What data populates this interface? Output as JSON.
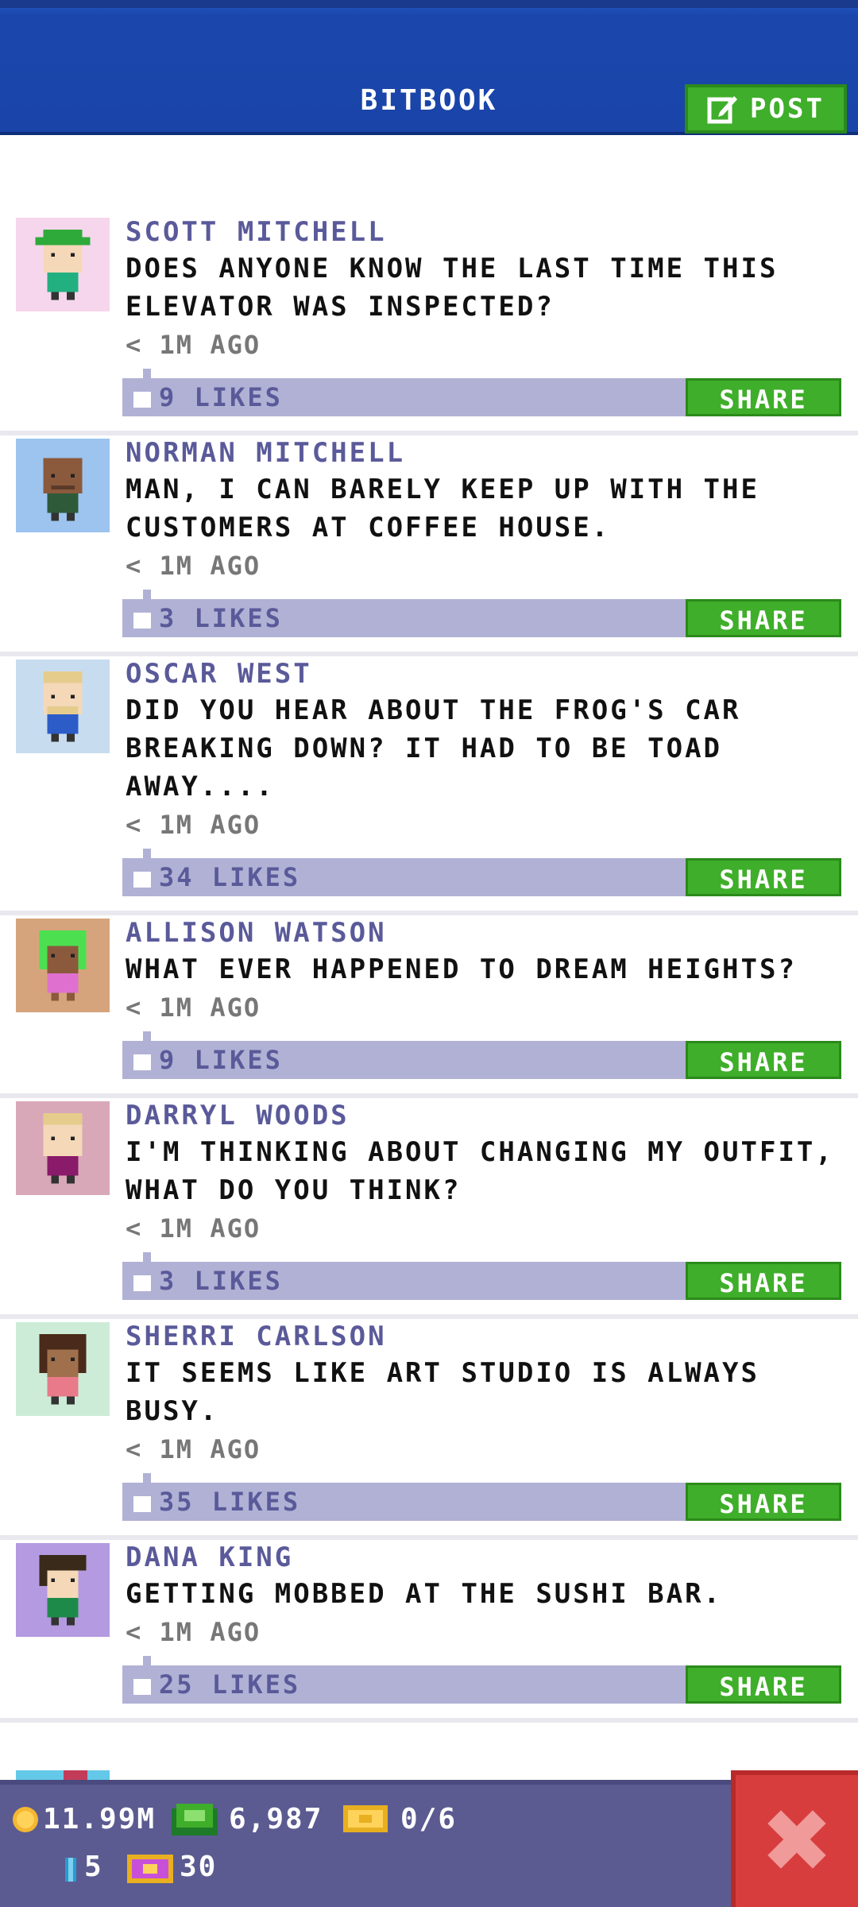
{
  "header": {
    "title": "BITBOOK",
    "post_label": "POST"
  },
  "posts": [
    {
      "name": "SCOTT MITCHELL",
      "message": "DOES ANYONE KNOW THE LAST TIME THIS ELEVATOR WAS INSPECTED?",
      "time": "< 1M AGO",
      "likes": "9 LIKES",
      "share": "SHARE",
      "avatar_bg": "#f6d6ec",
      "shirt": "#22b080",
      "hair": "#2eaa3a",
      "skin": "#f4d8b8"
    },
    {
      "name": "NORMAN MITCHELL",
      "message": "MAN, I CAN BARELY KEEP UP WITH THE CUSTOMERS AT COFFEE HOUSE.",
      "time": "< 1M AGO",
      "likes": "3 LIKES",
      "share": "SHARE",
      "avatar_bg": "#9cc4ee",
      "shirt": "#2e5a3a",
      "hair": "#8b5a3c",
      "skin": "#8b5a3c"
    },
    {
      "name": "OSCAR WEST",
      "message": "DID YOU HEAR ABOUT THE FROG'S CAR BREAKING DOWN? IT HAD TO BE TOAD AWAY....",
      "time": "< 1M AGO",
      "likes": "34 LIKES",
      "share": "SHARE",
      "avatar_bg": "#c8dcef",
      "shirt": "#2c5cc8",
      "hair": "#e6cc8c",
      "skin": "#f4d8b8"
    },
    {
      "name": "ALLISON WATSON",
      "message": "WHAT EVER HAPPENED TO DREAM HEIGHTS?",
      "time": "< 1M AGO",
      "likes": "9 LIKES",
      "share": "SHARE",
      "avatar_bg": "#d6a47c",
      "shirt": "#e070d0",
      "hair": "#4ce050",
      "skin": "#8b5a3c"
    },
    {
      "name": "DARRYL WOODS",
      "message": "I'M THINKING ABOUT CHANGING MY OUTFIT, WHAT DO YOU THINK?",
      "time": "< 1M AGO",
      "likes": "3 LIKES",
      "share": "SHARE",
      "avatar_bg": "#d8a8b8",
      "shirt": "#8a1a6a",
      "hair": "#e6cc8c",
      "skin": "#f4d8b8"
    },
    {
      "name": "SHERRI CARLSON",
      "message": "IT SEEMS LIKE ART STUDIO IS ALWAYS BUSY.",
      "time": "< 1M AGO",
      "likes": "35 LIKES",
      "share": "SHARE",
      "avatar_bg": "#cdecd8",
      "shirt": "#e87a8a",
      "hair": "#4a2a1a",
      "skin": "#a0704c"
    },
    {
      "name": "DANA KING",
      "message": "GETTING MOBBED AT THE SUSHI BAR.",
      "time": "< 1M AGO",
      "likes": "25 LIKES",
      "share": "SHARE",
      "avatar_bg": "#b49ae0",
      "shirt": "#1e8a4a",
      "hair": "#3a2a1a",
      "skin": "#f4d8b8"
    }
  ],
  "stats": {
    "coins": "11.99M",
    "bux": "6,987",
    "tickets": "0/6",
    "keys": "5",
    "vip": "30"
  },
  "colors": {
    "accent_blue": "#1a44a8",
    "share_green": "#3fae2a",
    "like_bar": "#b1b1d5",
    "name_purple": "#5a5a9a",
    "close_red": "#d83d3d"
  }
}
